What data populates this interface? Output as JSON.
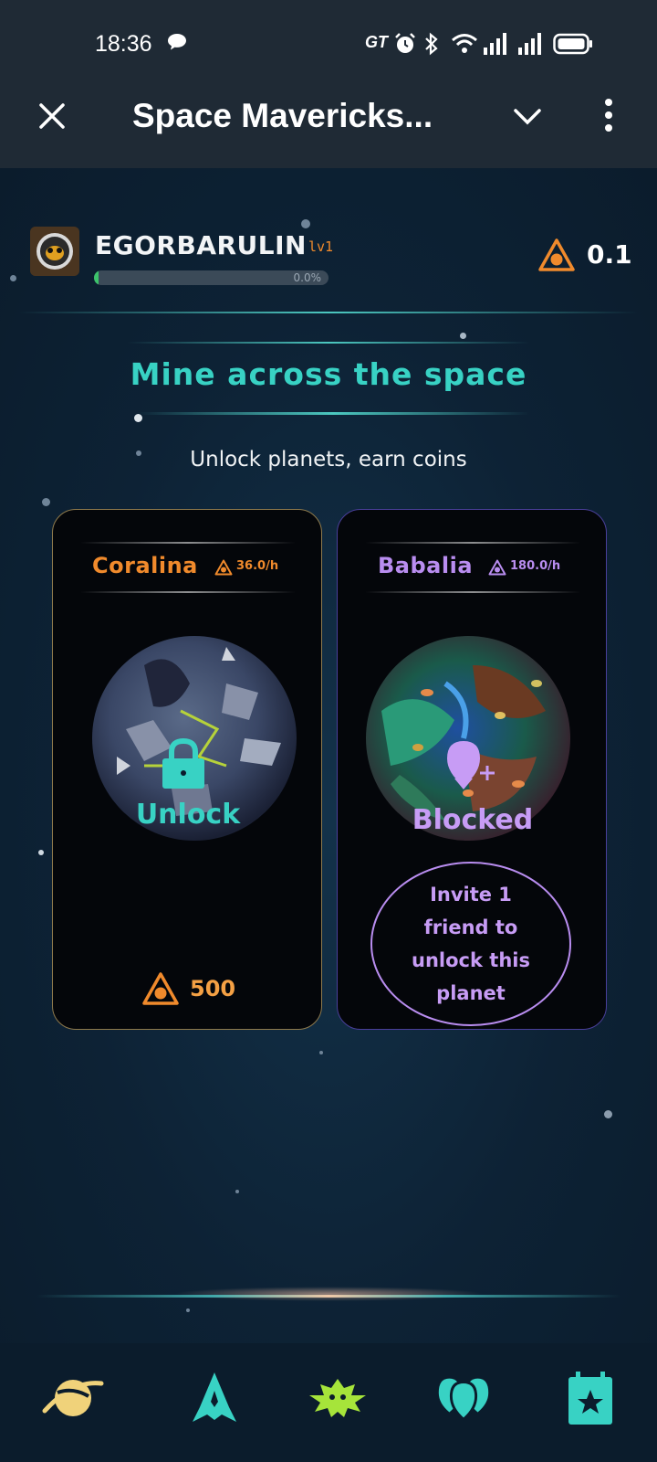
{
  "status_bar": {
    "time": "18:36",
    "carrier_badge": "GT",
    "icons": [
      "chat-bubble-icon",
      "alarm-icon",
      "bluetooth-icon",
      "wifi-icon",
      "signal-icon",
      "signal-icon",
      "battery-icon"
    ]
  },
  "app_bar": {
    "title": "Space Mavericks...",
    "close_icon": "close-icon",
    "dropdown_icon": "chevron-down-icon",
    "menu_icon": "more-vert-icon"
  },
  "profile": {
    "username": "EGORBARULIN",
    "level": "lv1",
    "progress_text": "0.0%",
    "progress_fraction": 0.02,
    "balance": "0.1"
  },
  "hero": {
    "title": "Mine across the space",
    "subtitle": "Unlock planets, earn coins"
  },
  "planets": [
    {
      "name": "Coralina",
      "rate": "36.0/h",
      "action": "Unlock",
      "cost": "500",
      "accent": "#f08a2c",
      "action_color": "#38d2c4"
    },
    {
      "name": "Babalia",
      "rate": "180.0/h",
      "action": "Blocked",
      "invite_text": "Invite 1 friend to unlock this planet",
      "accent": "#b98df0",
      "action_color": "#c79cf5"
    }
  ],
  "colors": {
    "accent_orange": "#f08a2c",
    "accent_teal": "#38d2c4",
    "accent_purple": "#b98df0",
    "background": "#0f1f30"
  },
  "bottom_nav": [
    "planet-icon",
    "ship-icon",
    "invader-icon",
    "friends-icon",
    "tasks-icon"
  ]
}
